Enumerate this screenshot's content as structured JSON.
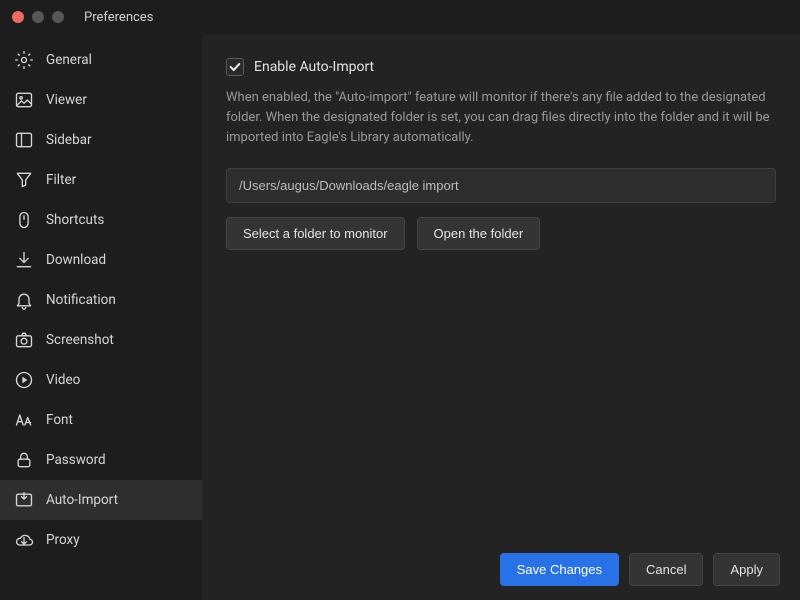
{
  "window": {
    "title": "Preferences"
  },
  "sidebar": {
    "items": [
      {
        "label": "General",
        "icon": "gear-icon",
        "active": false
      },
      {
        "label": "Viewer",
        "icon": "image-icon",
        "active": false
      },
      {
        "label": "Sidebar",
        "icon": "panel-icon",
        "active": false
      },
      {
        "label": "Filter",
        "icon": "funnel-icon",
        "active": false
      },
      {
        "label": "Shortcuts",
        "icon": "mouse-icon",
        "active": false
      },
      {
        "label": "Download",
        "icon": "download-icon",
        "active": false
      },
      {
        "label": "Notification",
        "icon": "bell-icon",
        "active": false
      },
      {
        "label": "Screenshot",
        "icon": "camera-icon",
        "active": false
      },
      {
        "label": "Video",
        "icon": "play-icon",
        "active": false
      },
      {
        "label": "Font",
        "icon": "font-icon",
        "active": false
      },
      {
        "label": "Password",
        "icon": "lock-icon",
        "active": false
      },
      {
        "label": "Auto-Import",
        "icon": "import-icon",
        "active": true
      },
      {
        "label": "Proxy",
        "icon": "cloud-icon",
        "active": false
      }
    ]
  },
  "autoImport": {
    "checkboxLabel": "Enable Auto-Import",
    "checked": true,
    "description": "When enabled, the \"Auto-import\" feature will monitor if there's any file added to the designated folder. When the designated folder is set, you can drag files directly into the folder and it will be imported into Eagle's Library automatically.",
    "path": "/Users/augus/Downloads/eagle import",
    "selectFolderBtn": "Select a folder to monitor",
    "openFolderBtn": "Open the folder"
  },
  "footer": {
    "save": "Save Changes",
    "cancel": "Cancel",
    "apply": "Apply"
  }
}
